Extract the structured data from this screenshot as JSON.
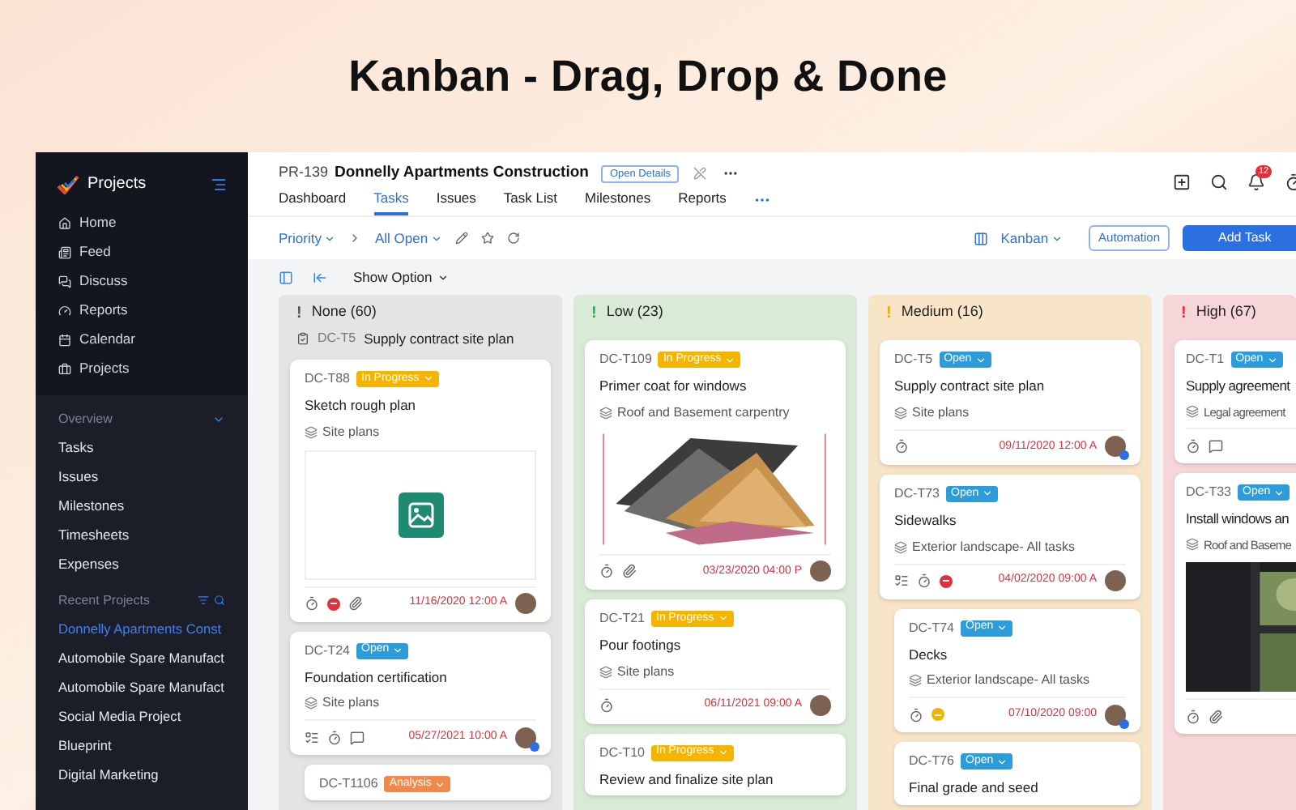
{
  "headline": "Kanban - Drag, Drop & Done",
  "sidebar": {
    "title": "Projects",
    "nav": [
      {
        "label": "Home",
        "kind": "home"
      },
      {
        "label": "Feed",
        "kind": "feed"
      },
      {
        "label": "Discuss",
        "kind": "discuss"
      },
      {
        "label": "Reports",
        "kind": "reports"
      },
      {
        "label": "Calendar",
        "kind": "calendar"
      },
      {
        "label": "Projects",
        "kind": "projects"
      }
    ],
    "overview_title": "Overview",
    "overview": [
      "Tasks",
      "Issues",
      "Milestones",
      "Timesheets",
      "Expenses"
    ],
    "recent_title": "Recent Projects",
    "recent": [
      {
        "label": "Donnelly Apartments Const",
        "selected": true
      },
      {
        "label": "Automobile Spare Manufact",
        "selected": false
      },
      {
        "label": "Automobile Spare Manufact",
        "selected": false
      },
      {
        "label": "Social Media Project",
        "selected": false
      },
      {
        "label": "Blueprint",
        "selected": false
      },
      {
        "label": "Digital Marketing",
        "selected": false
      }
    ]
  },
  "project": {
    "code": "PR-139",
    "name": "Donnelly Apartments Construction",
    "details_button": "Open Details",
    "notifications": "12"
  },
  "tabs": [
    {
      "label": "Dashboard",
      "selected": false
    },
    {
      "label": "Tasks",
      "selected": true
    },
    {
      "label": "Issues",
      "selected": false
    },
    {
      "label": "Task List",
      "selected": false
    },
    {
      "label": "Milestones",
      "selected": false
    },
    {
      "label": "Reports",
      "selected": false
    }
  ],
  "toolbar": {
    "filter": "Priority",
    "view": "All Open",
    "layout": "Kanban",
    "automation": "Automation",
    "add": "Add Task",
    "show_option": "Show Option"
  },
  "columns": [
    {
      "kind": "none",
      "mark": "!",
      "title": "None (60)",
      "parent": {
        "id": "DC-T5",
        "title": "Supply contract site plan"
      },
      "cards": [
        {
          "id": "DC-T88",
          "status": {
            "label": "In Progress",
            "color": "#f5b400"
          },
          "title": "Sketch rough plan",
          "list": "Site plans",
          "media": {
            "kind": "placeholder"
          },
          "icons": [
            {
              "kind": "timer"
            },
            {
              "kind": "stop"
            },
            {
              "kind": "clip"
            }
          ],
          "date": "11/16/2020 12:00 A",
          "avatar_badge": false,
          "subtask": false
        },
        {
          "id": "DC-T24",
          "status": {
            "label": "Open",
            "color": "#2d9cdb"
          },
          "title": "Foundation certification",
          "list": "Site plans",
          "icons": [
            {
              "kind": "list"
            },
            {
              "kind": "timer"
            },
            {
              "kind": "chat"
            }
          ],
          "date": "05/27/2021 10:00 A",
          "avatar_badge": true,
          "subtask": false
        },
        {
          "id": "DC-T1106",
          "status": {
            "label": "Analysis",
            "color": "#f0894b"
          },
          "subtask": true
        }
      ]
    },
    {
      "kind": "low",
      "mark": "!",
      "title": "Low (23)",
      "cards": [
        {
          "id": "DC-T109",
          "status": {
            "label": "In Progress",
            "color": "#f5b400"
          },
          "title": "Primer coat for windows",
          "list": "Roof and Basement carpentry",
          "media": {
            "kind": "picture"
          },
          "icons": [
            {
              "kind": "timer"
            },
            {
              "kind": "clip"
            }
          ],
          "date": "03/23/2020 04:00 P",
          "avatar_badge": false,
          "subtask": false
        },
        {
          "id": "DC-T21",
          "status": {
            "label": "In Progress",
            "color": "#f5b400"
          },
          "title": "Pour footings",
          "list": "Site plans",
          "icons": [
            {
              "kind": "timer"
            }
          ],
          "date": "06/11/2021 09:00 A",
          "avatar_badge": false,
          "subtask": false
        },
        {
          "id": "DC-T10",
          "status": {
            "label": "In Progress",
            "color": "#f5b400"
          },
          "title": "Review and finalize site plan",
          "subtask": false
        }
      ]
    },
    {
      "kind": "medium",
      "mark": "!",
      "title": "Medium (16)",
      "cards": [
        {
          "id": "DC-T5",
          "status": {
            "label": "Open",
            "color": "#2d9cdb"
          },
          "title": "Supply contract site plan",
          "list": "Site plans",
          "icons": [
            {
              "kind": "timer"
            }
          ],
          "date": "09/11/2020 12:00 A",
          "avatar_badge": true,
          "subtask": false
        },
        {
          "id": "DC-T73",
          "status": {
            "label": "Open",
            "color": "#2d9cdb"
          },
          "title": "Sidewalks",
          "list": "Exterior landscape- All tasks",
          "icons": [
            {
              "kind": "list"
            },
            {
              "kind": "timer"
            },
            {
              "kind": "stop"
            }
          ],
          "date": "04/02/2020 09:00 A",
          "avatar_badge": false,
          "subtask": false
        },
        {
          "id": "DC-T74",
          "status": {
            "label": "Open",
            "color": "#2d9cdb"
          },
          "title": "Decks",
          "list": "Exterior landscape- All tasks",
          "icons": [
            {
              "kind": "timer"
            },
            {
              "kind": "pause"
            }
          ],
          "date": "07/10/2020 09:00",
          "avatar_badge": true,
          "subtask": true
        },
        {
          "id": "DC-T76",
          "status": {
            "label": "Open",
            "color": "#2d9cdb"
          },
          "title": "Final grade and seed",
          "subtask": true
        }
      ]
    },
    {
      "kind": "high",
      "mark": "!",
      "title": "High (67)",
      "cards": [
        {
          "id": "DC-T1",
          "status": {
            "label": "Open",
            "color": "#2d9cdb"
          },
          "title": "Supply agreement",
          "list": "Legal agreement",
          "icons": [
            {
              "kind": "timer"
            },
            {
              "kind": "chat"
            }
          ],
          "subtask": false
        },
        {
          "id": "DC-T33",
          "status": {
            "label": "Open",
            "color": "#2d9cdb"
          },
          "title": "Install windows an",
          "list": "Roof and Baseme",
          "media": {
            "kind": "picture"
          },
          "icons": [
            {
              "kind": "timer"
            },
            {
              "kind": "clip"
            }
          ],
          "subtask": false
        }
      ]
    }
  ]
}
